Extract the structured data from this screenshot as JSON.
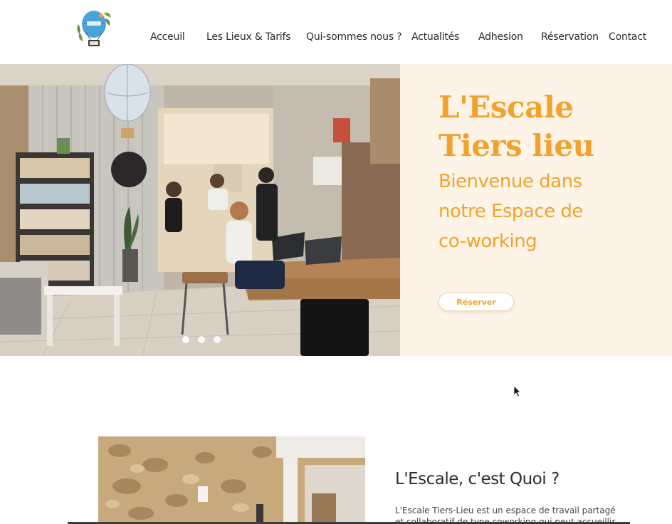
{
  "nav": {
    "items": [
      "Acceuil",
      "Les Lieux & Tarifs",
      "Qui-sommes nous ?",
      "Actualités",
      "Adhesion",
      "Réservation",
      "Contact"
    ]
  },
  "hero": {
    "title_line1": "L'Escale",
    "title_line2": "Tiers lieu",
    "subtitle_line1": "Bienvenue dans",
    "subtitle_line2": "notre Espace de",
    "subtitle_line3": "co-working",
    "button_label": "Réserver",
    "slide_count": 3,
    "active_slide": 1
  },
  "about": {
    "title": "L'Escale, c'est Quoi ?",
    "text_line1": "L'Escale Tiers-Lieu est un espace de travail partagé",
    "text_line2": "et collaboratif de type coworking qui peut accueillir"
  },
  "colors": {
    "accent": "#f2a22c",
    "hero_panel_bg": "#fdf4e7",
    "nav_text": "#2b2b2b"
  },
  "icons": {
    "logo": "hot-air-balloon-logo",
    "cursor": "mouse-pointer-icon"
  }
}
